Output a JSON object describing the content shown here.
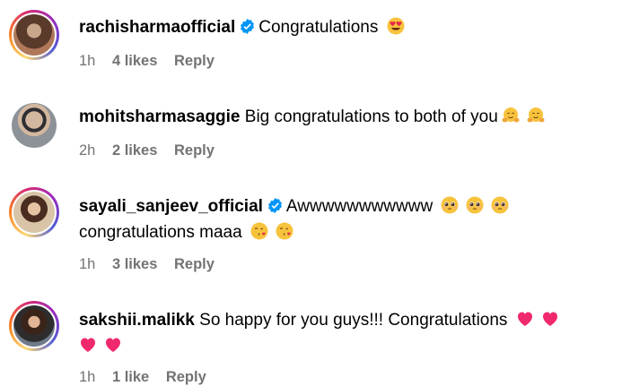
{
  "comments": [
    {
      "username": "rachisharmaofficial",
      "verified": true,
      "text": "Congratulations",
      "emojis": [
        "heart-eyes-emoji"
      ],
      "time": "1h",
      "likes": "4 likes",
      "reply": "Reply"
    },
    {
      "username": "mohitsharmasaggie",
      "verified": false,
      "text": "Big congratulations to both of you",
      "emojis": [
        "hugging-face-emoji",
        "hugging-face-emoji"
      ],
      "time": "2h",
      "likes": "2 likes",
      "reply": "Reply"
    },
    {
      "username": "sayali_sanjeev_official",
      "verified": true,
      "text": "Awwwwwwwwwww",
      "text2": "congratulations maaa",
      "emojis": [
        "pleading-face-emoji",
        "pleading-face-emoji",
        "pleading-face-emoji"
      ],
      "emojis2": [
        "face-blowing-kiss-emoji",
        "face-blowing-kiss-emoji"
      ],
      "time": "1h",
      "likes": "3 likes",
      "reply": "Reply"
    },
    {
      "username": "sakshii.malikk",
      "verified": false,
      "text": "So happy for you guys!!! Congratulations",
      "emojis": [
        "pink-heart-emoji",
        "pink-heart-emoji"
      ],
      "emojis2": [
        "pink-heart-emoji",
        "pink-heart-emoji"
      ],
      "time": "1h",
      "likes": "1 like",
      "reply": "Reply"
    }
  ],
  "colors": {
    "text": "#000000",
    "meta": "#737373",
    "verified": "#0095f6",
    "heart": "#f0286e"
  }
}
